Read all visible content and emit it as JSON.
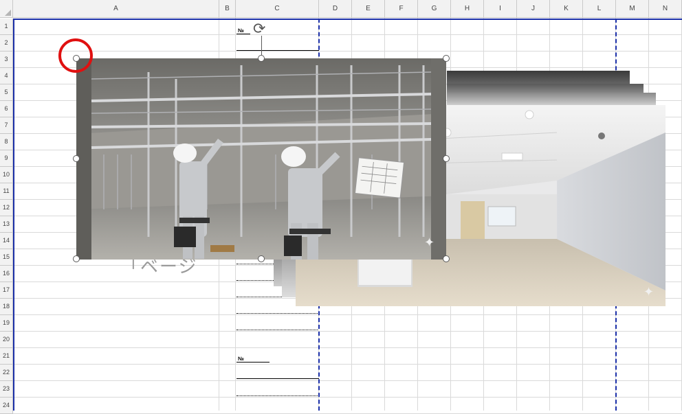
{
  "sheet": {
    "columns": [
      "A",
      "B",
      "C",
      "D",
      "E",
      "F",
      "G",
      "H",
      "I",
      "J",
      "K",
      "L",
      "M",
      "N"
    ],
    "rows": [
      "1",
      "2",
      "3",
      "4",
      "5",
      "6",
      "7",
      "8",
      "9",
      "10",
      "11",
      "12",
      "13",
      "14",
      "15",
      "16",
      "17",
      "18",
      "19",
      "20",
      "21",
      "22",
      "23",
      "24"
    ]
  },
  "form": {
    "no_label_top": "№",
    "no_label_bottom": "№"
  },
  "shape": {
    "hint_text": "「ベージ"
  },
  "images": [
    {
      "name": "construction-photo",
      "description_icon": "workers-installing-ceiling-frame"
    },
    {
      "name": "finished-room-photo",
      "description_icon": "empty-finished-office-room"
    }
  ],
  "colors": {
    "accent_pagebreak": "#1b2fa8",
    "highlight": "#e01010"
  }
}
